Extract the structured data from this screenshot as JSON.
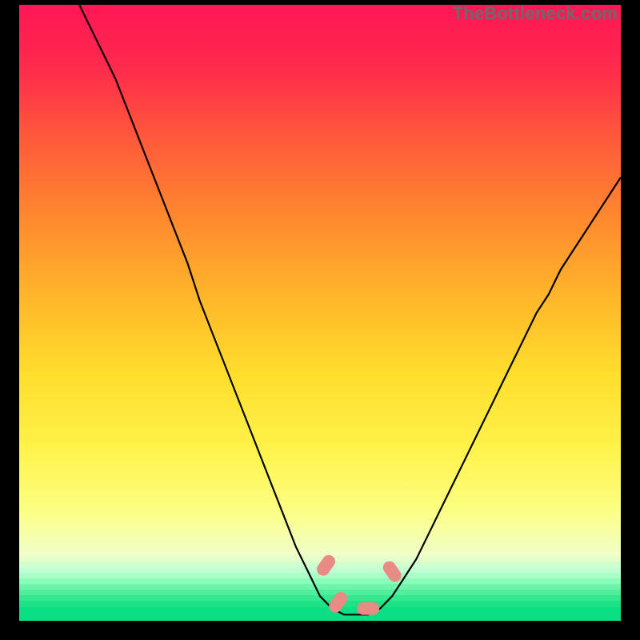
{
  "watermark": "TheBottleneck.com",
  "chart_data": {
    "type": "line",
    "title": "",
    "xlabel": "",
    "ylabel": "",
    "xlim": [
      0,
      100
    ],
    "ylim": [
      0,
      100
    ],
    "x": [
      10,
      12,
      14,
      16,
      18,
      20,
      22,
      24,
      26,
      28,
      30,
      32,
      34,
      36,
      38,
      40,
      42,
      44,
      46,
      48,
      50,
      52,
      54,
      56,
      58,
      60,
      62,
      64,
      66,
      68,
      70,
      72,
      74,
      76,
      78,
      80,
      82,
      84,
      86,
      88,
      90,
      92,
      94,
      96,
      98,
      100
    ],
    "values": [
      100,
      96,
      92,
      88,
      83,
      78,
      73,
      68,
      63,
      58,
      52,
      47,
      42,
      37,
      32,
      27,
      22,
      17,
      12,
      8,
      4,
      2,
      1,
      1,
      1,
      2,
      4,
      7,
      10,
      14,
      18,
      22,
      26,
      30,
      34,
      38,
      42,
      46,
      50,
      53,
      57,
      60,
      63,
      66,
      69,
      72
    ],
    "annotations": [
      {
        "text": "pink-dash",
        "x": 51,
        "y": 9
      },
      {
        "text": "pink-dash",
        "x": 53,
        "y": 3
      },
      {
        "text": "pink-dash",
        "x": 58,
        "y": 2
      },
      {
        "text": "pink-dash",
        "x": 62,
        "y": 8
      }
    ],
    "gradient_stops": [
      {
        "pos": 0.0,
        "color": "#ff1656"
      },
      {
        "pos": 0.1,
        "color": "#ff2a4c"
      },
      {
        "pos": 0.22,
        "color": "#ff5a3a"
      },
      {
        "pos": 0.35,
        "color": "#ff8a2e"
      },
      {
        "pos": 0.48,
        "color": "#ffb82a"
      },
      {
        "pos": 0.6,
        "color": "#ffde2c"
      },
      {
        "pos": 0.72,
        "color": "#fff24a"
      },
      {
        "pos": 0.82,
        "color": "#fcff82"
      },
      {
        "pos": 0.88,
        "color": "#f2ffbc"
      },
      {
        "pos": 0.925,
        "color": "#d2ffcf"
      },
      {
        "pos": 0.955,
        "color": "#7cf7a4"
      },
      {
        "pos": 0.985,
        "color": "#1de386"
      },
      {
        "pos": 1.0,
        "color": "#0adf84"
      }
    ],
    "bottom_bands": [
      {
        "top_pct": 88.5,
        "h_pct": 1.0,
        "c": "#f1ffc4"
      },
      {
        "top_pct": 89.5,
        "h_pct": 0.9,
        "c": "#e4ffca"
      },
      {
        "top_pct": 90.4,
        "h_pct": 0.9,
        "c": "#d2ffcf"
      },
      {
        "top_pct": 91.3,
        "h_pct": 0.9,
        "c": "#c0ffd0"
      },
      {
        "top_pct": 92.2,
        "h_pct": 0.9,
        "c": "#a8ffc8"
      },
      {
        "top_pct": 93.1,
        "h_pct": 0.9,
        "c": "#8cfcbb"
      },
      {
        "top_pct": 94.0,
        "h_pct": 0.9,
        "c": "#6ff5ab"
      },
      {
        "top_pct": 94.9,
        "h_pct": 0.9,
        "c": "#50ee9c"
      },
      {
        "top_pct": 95.8,
        "h_pct": 0.9,
        "c": "#34e890"
      },
      {
        "top_pct": 96.7,
        "h_pct": 1.1,
        "c": "#1de386"
      },
      {
        "top_pct": 97.8,
        "h_pct": 2.2,
        "c": "#0adf84"
      }
    ]
  }
}
